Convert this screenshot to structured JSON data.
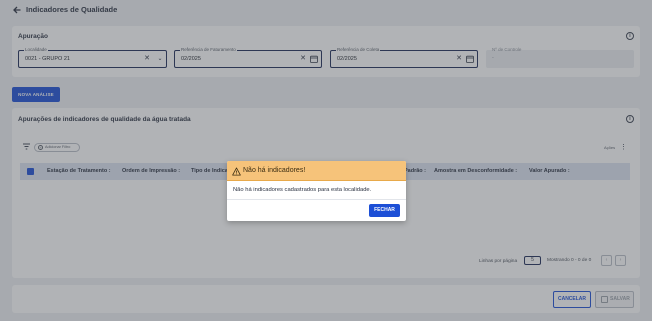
{
  "header": {
    "title": "Indicadores de Qualidade"
  },
  "apuracao": {
    "title": "Apuração",
    "localidade": {
      "label": "Localidade",
      "value": "0021 - GRUPO 21"
    },
    "ref_faturamento": {
      "label": "Referência de Faturamento",
      "value": "02/2025"
    },
    "ref_coleta": {
      "label": "Referência de Coleta",
      "value": "02/2025"
    },
    "n_controle": {
      "label": "Nº de Controle",
      "value": "-"
    }
  },
  "actions": {
    "nova_analise": "NOVA ANÁLISE"
  },
  "table_section": {
    "title": "Apurações de indicadores de qualidade da água tratada",
    "add_filter": "Adicionar Filtro",
    "acoes": "Ações",
    "columns": [
      "Estação de Tratamento",
      "Ordem de Impressão",
      "Tipo de Indicador",
      "Padrão",
      "Amostra em Desconformidade",
      "Valor Apurado"
    ],
    "pagination": {
      "rows_label": "Linhas por página",
      "rows_value": "5",
      "showing": "Mostrando 0 - 0 de 0"
    }
  },
  "footer": {
    "cancel": "CANCELAR",
    "save": "SALVAR"
  },
  "modal": {
    "title": "Não há indicadores!",
    "message": "Não há indicadores cadastrados para esta localidade.",
    "close": "FECHAR"
  },
  "colors": {
    "primary": "#1c4fd6",
    "warning_bg": "#f6c37a",
    "table_header": "#dde4f1"
  }
}
